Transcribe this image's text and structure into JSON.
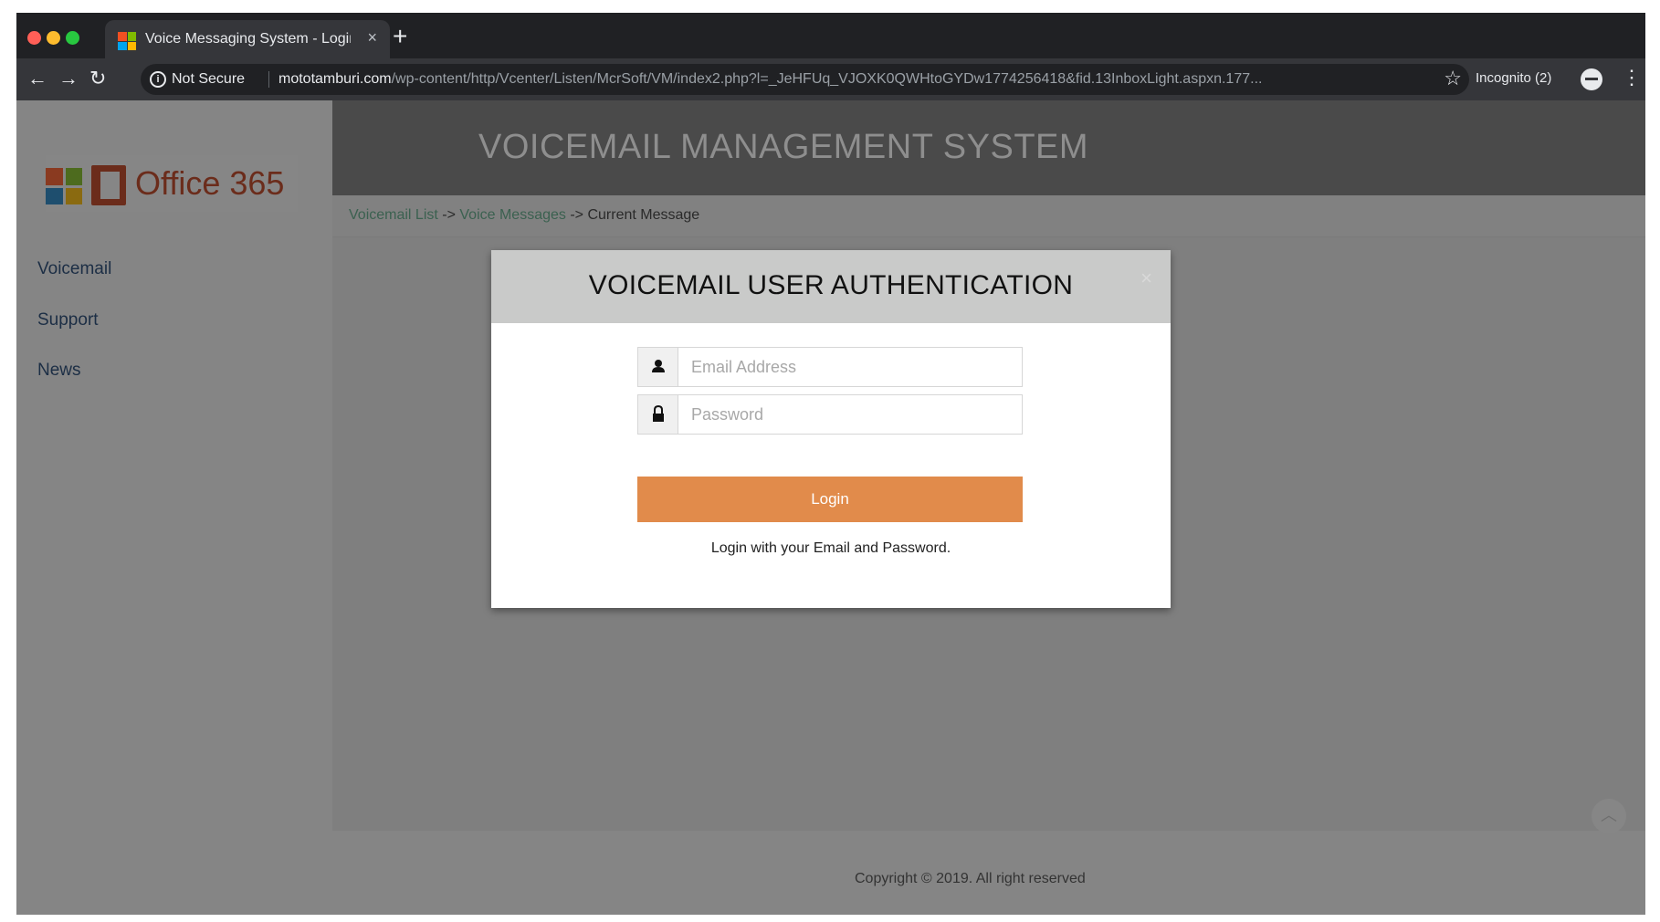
{
  "browser": {
    "tab_title": "Voice Messaging System - Login",
    "new_tab_label": "+",
    "security_label": "Not Secure",
    "url_domain": "mototamburi.com",
    "url_path": "/wp-content/http/Vcenter/Listen/McrSoft/VM/index2.php?l=_JeHFUq_VJOXK0QWHtoGYDw1774256418&fid.13InboxLight.aspxn.177...",
    "incognito_label": "Incognito (2)",
    "colors": {
      "tabbar": "#202124",
      "toolbar": "#35363a",
      "traffic_red": "#ff5f57",
      "traffic_yellow": "#febc2e",
      "traffic_green": "#28c840"
    }
  },
  "sidebar": {
    "logo_text": "Office 365",
    "items": [
      {
        "label": "Voicemail"
      },
      {
        "label": "Support"
      },
      {
        "label": "News"
      }
    ]
  },
  "header": {
    "title": "VOICEMAIL MANAGEMENT SYSTEM"
  },
  "breadcrumb": {
    "items": [
      "Voicemail List",
      "Voice Messages",
      "Current Message"
    ],
    "separator": " -> "
  },
  "modal": {
    "title": "VOICEMAIL USER AUTHENTICATION",
    "close_symbol": "×",
    "email_placeholder": "Email Address",
    "password_placeholder": "Password",
    "login_label": "Login",
    "hint": "Login with your Email and Password.",
    "colors": {
      "login_button": "#e18b4b",
      "header": "#c9cac9"
    }
  },
  "footer": {
    "copyright": "Copyright © 2019. All right reserved"
  },
  "icons": [
    "back-arrow-icon",
    "forward-arrow-icon",
    "reload-icon",
    "info-icon",
    "star-icon",
    "incognito-icon",
    "menu-icon",
    "user-icon",
    "lock-icon",
    "close-icon",
    "chevron-up-icon"
  ]
}
